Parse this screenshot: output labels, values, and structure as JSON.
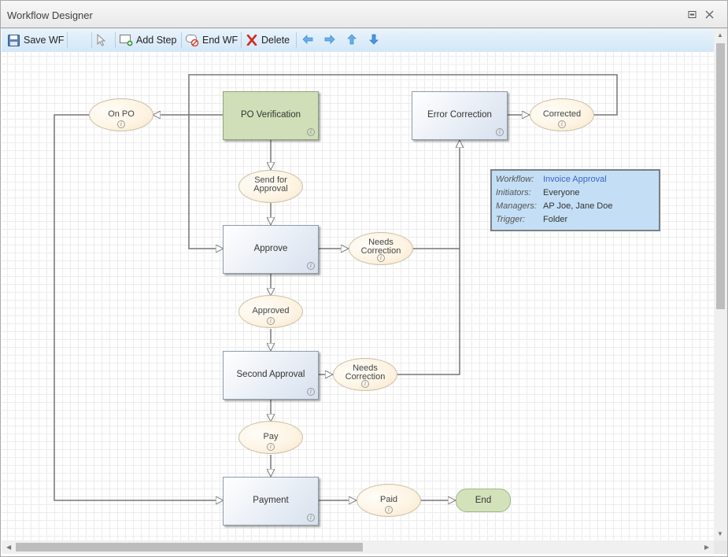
{
  "window": {
    "title": "Workflow Designer",
    "buttons": [
      {
        "name": "restore",
        "icon": "restore-icon",
        "glyph": "▣"
      },
      {
        "name": "close",
        "icon": "close-icon",
        "glyph": "✕"
      }
    ]
  },
  "toolbar": {
    "save_label": "Save WF",
    "add_step_label": "Add Step",
    "end_wf_label": "End WF",
    "delete_label": "Delete",
    "icons": {
      "save": "floppy-disk-icon",
      "select": "pointer-icon",
      "add_step": "add-step-icon",
      "end_wf": "end-workflow-icon",
      "delete": "delete-x-icon",
      "left": "arrow-left-icon",
      "right": "arrow-right-icon",
      "up": "arrow-up-icon",
      "down": "arrow-down-icon"
    },
    "arrow_color": "#3d8fd8",
    "delete_color": "#d22b1e"
  },
  "workflow": {
    "steps": [
      {
        "id": "po-verification",
        "label": "PO Verification",
        "type": "start"
      },
      {
        "id": "error-correction",
        "label": "Error Correction",
        "type": "step"
      },
      {
        "id": "approve",
        "label": "Approve",
        "type": "step"
      },
      {
        "id": "second-approval",
        "label": "Second Approval",
        "type": "step"
      },
      {
        "id": "payment",
        "label": "Payment",
        "type": "step"
      }
    ],
    "states": [
      {
        "id": "on-po",
        "lines": [
          "On PO"
        ]
      },
      {
        "id": "send-for-approval",
        "lines": [
          "Send for",
          "Approval"
        ]
      },
      {
        "id": "corrected",
        "lines": [
          "Corrected"
        ]
      },
      {
        "id": "needs-correction-1",
        "lines": [
          "Needs",
          "Correction"
        ]
      },
      {
        "id": "approved",
        "lines": [
          "Approved"
        ]
      },
      {
        "id": "needs-correction-2",
        "lines": [
          "Needs",
          "Correction"
        ]
      },
      {
        "id": "pay",
        "lines": [
          "Pay"
        ]
      },
      {
        "id": "paid",
        "lines": [
          "Paid"
        ]
      }
    ],
    "end": {
      "label": "End"
    },
    "info_glyph": "i",
    "colors": {
      "start_step": "#d0dfb8",
      "step": "#e9eef6",
      "state": "#fdf3e2",
      "end": "#d3e2bb",
      "connector": "#777777"
    }
  },
  "info_panel": {
    "rows": [
      {
        "key": "Workflow:",
        "value": "Invoice Approval",
        "highlight": true
      },
      {
        "key": "Initiators:",
        "value": "Everyone"
      },
      {
        "key": "Managers:",
        "value": "AP Joe, Jane Doe"
      },
      {
        "key": "Trigger:",
        "value": "Folder"
      }
    ],
    "highlight_color": "#3a63c8",
    "background": "#c4dff5"
  }
}
